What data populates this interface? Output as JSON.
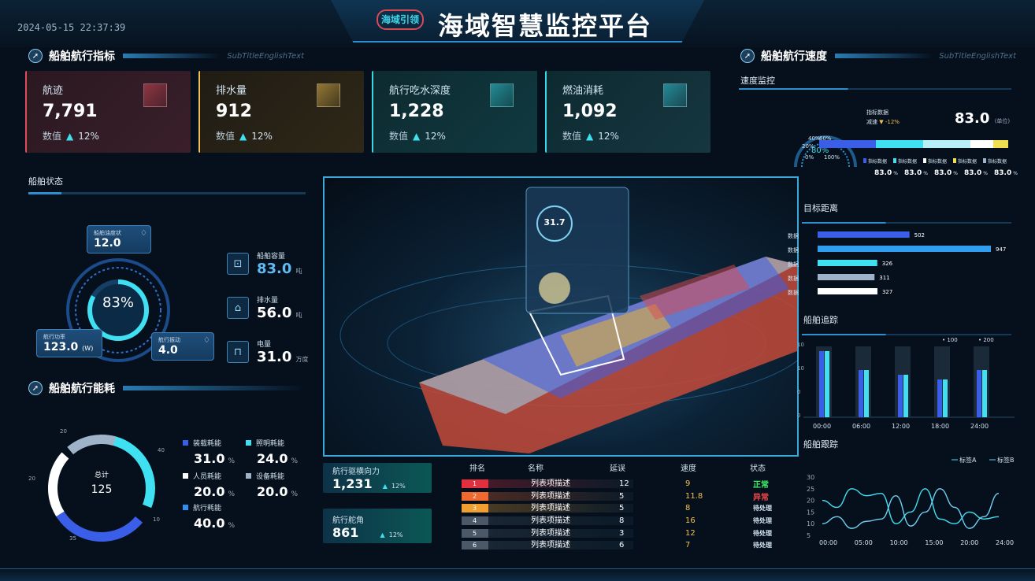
{
  "header": {
    "title": "海域智慧监控平台",
    "logo_text": "海域引领",
    "datetime": "2024-05-15 22:37:39"
  },
  "colors": {
    "bg": "#06101c",
    "accent": "#2a8fd0",
    "cyan": "#3ee0f2",
    "card_red": "#e04c5a",
    "card_yellow": "#f0c050",
    "card_cyan": "#36d8e6"
  },
  "left": {
    "indicators": {
      "title": "船舶航行指标",
      "subtitle": "SubTitleEnglishText",
      "cards": [
        {
          "label": "航迹",
          "value": "7,791",
          "sub_label": "数值",
          "change": "12%"
        },
        {
          "label": "排水量",
          "value": "912",
          "sub_label": "数值",
          "change": "12%"
        },
        {
          "label": "航行吃水深度",
          "value": "1,228",
          "sub_label": "数值",
          "change": "12%"
        },
        {
          "label": "燃油消耗",
          "value": "1,092",
          "sub_label": "数值",
          "change": "12%"
        }
      ]
    },
    "status": {
      "title": "船舶状态",
      "gauge_percent": "83%",
      "gauge_level": 0.83,
      "bubble_top": {
        "label": "船舶油度状",
        "value": "12.0"
      },
      "bubble_left": {
        "label": "航行功率",
        "value": "123.0",
        "unit": "(W)"
      },
      "bubble_right": {
        "label": "航行振动",
        "value": "4.0"
      },
      "items": [
        {
          "icon": "cup-icon",
          "label": "船舶容量",
          "value": "83.0",
          "unit": "吨"
        },
        {
          "icon": "home-icon",
          "label": "排水量",
          "value": "56.0",
          "unit": "吨"
        },
        {
          "icon": "seat-icon",
          "label": "电量",
          "value": "31.0",
          "unit": "万度"
        }
      ]
    },
    "energy": {
      "title": "船舶航行能耗",
      "center_label": "总计",
      "center_value": "125",
      "ring_ticks": [
        "20",
        "40",
        "20",
        "10",
        "35"
      ],
      "legend": [
        {
          "label": "装载耗能",
          "value": "31.0",
          "unit": "%",
          "color": "#3a5ee8"
        },
        {
          "label": "照明耗能",
          "value": "24.0",
          "unit": "%",
          "color": "#3ee0f2"
        },
        {
          "label": "人员耗能",
          "value": "20.0",
          "unit": "%",
          "color": "#ffffff"
        },
        {
          "label": "设备耗能",
          "value": "20.0",
          "unit": "%",
          "color": "#9fb3c8"
        },
        {
          "label": "航行耗能",
          "value": "40.0",
          "unit": "%",
          "color": "#2f8ef0"
        }
      ]
    }
  },
  "center": {
    "ship_display_value": "31.7",
    "mini_cards": [
      {
        "label": "航行驱横向力",
        "value": "1,231",
        "change": "12%"
      },
      {
        "label": "航行舵角",
        "value": "861",
        "change": "12%"
      }
    ],
    "table": {
      "headers": [
        "排名",
        "名称",
        "延误",
        "速度",
        "状态"
      ],
      "rows": [
        {
          "rank": "1",
          "name": "列表项描述",
          "delay": "12",
          "speed": "9",
          "status": "正常",
          "rank_color": "#e03040",
          "status_color": "#3ef06a"
        },
        {
          "rank": "2",
          "name": "列表项描述",
          "delay": "5",
          "speed": "11.8",
          "status": "异常",
          "rank_color": "#f06a30",
          "status_color": "#f04848"
        },
        {
          "rank": "3",
          "name": "列表项描述",
          "delay": "5",
          "speed": "8",
          "status": "待处理",
          "rank_color": "#f0a030",
          "status_color": "#cfe1ee"
        },
        {
          "rank": "4",
          "name": "列表项描述",
          "delay": "8",
          "speed": "16",
          "status": "待处理",
          "rank_color": "#4a5868",
          "status_color": "#cfe1ee"
        },
        {
          "rank": "5",
          "name": "列表项描述",
          "delay": "3",
          "speed": "12",
          "status": "待处理",
          "rank_color": "#4a5868",
          "status_color": "#cfe1ee"
        },
        {
          "rank": "6",
          "name": "列表项描述",
          "delay": "6",
          "speed": "7",
          "status": "待处理",
          "rank_color": "#4a5868",
          "status_color": "#cfe1ee"
        }
      ]
    }
  },
  "right": {
    "speed": {
      "title": "船舶航行速度",
      "subtitle": "SubTitleEnglishText",
      "section": "速度监控",
      "indicator_label": "指标数据",
      "trend_label": "减速",
      "trend_value": "-12%",
      "big_value": "83.0",
      "big_unit": "(单位)",
      "gauge_labels": [
        "40%",
        "60%",
        "20%",
        "80%",
        "0%",
        "100%"
      ],
      "gauge_level": 0.8,
      "bar_segments": [
        {
          "color": "#3a5ee8",
          "value": 30
        },
        {
          "color": "#3ee0f2",
          "value": 25
        },
        {
          "color": "#b8f0f8",
          "value": 25
        },
        {
          "color": "#ffffff",
          "value": 12
        },
        {
          "color": "#f0e050",
          "value": 8
        }
      ],
      "legend": [
        {
          "label": "指标数据",
          "value": "83.0",
          "unit": "%",
          "color": "#3a5ee8"
        },
        {
          "label": "指标数据",
          "value": "83.0",
          "unit": "%",
          "color": "#3ee0f2"
        },
        {
          "label": "指标数据",
          "value": "83.0",
          "unit": "%",
          "color": "#ffffff"
        },
        {
          "label": "指标数据",
          "value": "83.0",
          "unit": "%",
          "color": "#f0e050"
        },
        {
          "label": "指标数据",
          "value": "83.0",
          "unit": "%",
          "color": "#9fb3c8"
        }
      ]
    },
    "target": {
      "title": "目标距离"
    },
    "track": {
      "title": "船舶追踪"
    },
    "follow": {
      "title": "船舶跟踪"
    }
  },
  "chart_data": [
    {
      "type": "bar",
      "title": "目标距离",
      "categories": [
        "数据",
        "数据",
        "数据",
        "数据",
        "数据"
      ],
      "values": [
        502,
        947,
        326,
        311,
        327
      ],
      "colors": [
        "#3a5ee8",
        "#2f9ef0",
        "#3ee0f2",
        "#9fb3c8",
        "#ffffff"
      ],
      "xlim": [
        0,
        947
      ]
    },
    {
      "type": "bar",
      "title": "船舶追踪",
      "categories": [
        "00:00",
        "06:00",
        "12:00",
        "18:00",
        "24:00"
      ],
      "series": [
        {
          "name": "100",
          "values": [
            28,
            20,
            18,
            16,
            20
          ],
          "color": "#3a5ee8"
        },
        {
          "name": "200",
          "values": [
            28,
            20,
            18,
            16,
            20
          ],
          "color": "#3ee0f2"
        }
      ],
      "yticks": [
        "10",
        "10",
        "0",
        "0"
      ],
      "ylim": [
        0,
        30
      ]
    },
    {
      "type": "line",
      "title": "船舶跟踪",
      "x": [
        "00:00",
        "05:00",
        "10:00",
        "15:00",
        "20:00",
        "24:00"
      ],
      "yticks": [
        "30",
        "25",
        "20",
        "15",
        "10",
        "5"
      ],
      "ylim": [
        5,
        30
      ],
      "series": [
        {
          "name": "标签A",
          "values": [
            20,
            17,
            25,
            22,
            23,
            10,
            15,
            25,
            12,
            10,
            15,
            12,
            13
          ],
          "color": "#3ee0f2"
        },
        {
          "name": "标签B",
          "values": [
            10,
            13,
            8,
            11,
            12,
            22,
            9,
            15,
            25,
            17,
            8,
            13,
            23
          ],
          "color": "#6fd0f0"
        }
      ]
    }
  ]
}
